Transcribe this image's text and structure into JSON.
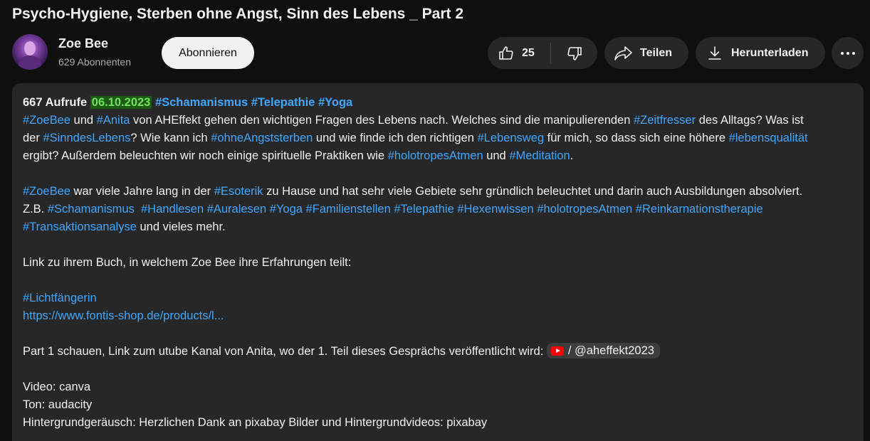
{
  "video": {
    "title": "Psycho-Hygiene, Sterben ohne Angst, Sinn des Lebens _ Part 2"
  },
  "channel": {
    "name": "Zoe Bee",
    "subscribers": "629 Abonnenten",
    "subscribe_label": "Abonnieren"
  },
  "actions": {
    "like_count": "25",
    "share_label": "Teilen",
    "download_label": "Herunterladen"
  },
  "description": {
    "views": "667 Aufrufe",
    "date": "06.10.2023",
    "header_tags": [
      "#Schamanismus",
      "#Telepathie",
      "#Yoga"
    ],
    "p1": {
      "t1": "#ZoeBee",
      "s1": " und ",
      "t2": "#Anita",
      "s2": " von AHEffekt gehen den wichtigen Fragen des Lebens nach. Welches sind die manipulierenden ",
      "t3": "#Zeitfresser",
      "s3": " des Alltags? Was ist",
      "s4": "der ",
      "t4": "#SinndesLebens",
      "s5": "? Wie kann ich ",
      "t5": "#ohneAngststerben",
      "s6": " und wie finde ich den richtigen ",
      "t6": "#Lebensweg",
      "s7": " für mich, so dass sich eine höhere ",
      "t7": "#lebensqualität",
      "s8": "ergibt? Außerdem beleuchten wir noch einige spirituelle Praktiken wie ",
      "t8": "#holotropesAtmen",
      "s9": " und ",
      "t9": "#Meditation",
      "s10": "."
    },
    "p2": {
      "t1": "#ZoeBee",
      "s1": " war viele Jahre lang in der ",
      "t2": "#Esoterik",
      "s2": " zu Hause und hat sehr viele Gebiete sehr gründlich beleuchtet und darin auch Ausbildungen absolviert.",
      "s3": "Z.B. ",
      "tags": [
        "#Schamanismus",
        "#Handlesen",
        "#Auralesen",
        "#Yoga",
        "#Familienstellen",
        "#Telepathie",
        "#Hexenwissen",
        "#holotropesAtmen",
        "#Reinkarnationstherapie"
      ],
      "t3": "#Transaktionsanalyse",
      "s4": " und vieles mehr."
    },
    "book_intro": "Link zu ihrem Buch, in welchem Zoe Bee ihre Erfahrungen teilt:",
    "book_tag": "#Lichtfängerin",
    "book_link": "https://www.fontis-shop.de/products/l...",
    "part1_text": "Part 1 schauen, Link zum utube Kanal von Anita, wo der 1. Teil dieses Gesprächs veröffentlicht wird: ",
    "part1_chip": "/ @aheffekt2023",
    "credits": [
      "Video: canva",
      "Ton: audacity",
      "Hintergrundgeräusch: Herzlichen Dank an pixabay Bilder und Hintergrundvideos: pixabay"
    ]
  },
  "colors": {
    "background": "#0f0f0f",
    "panel": "#272727",
    "link": "#3ea6ff",
    "date_highlight": "#1f5a14"
  },
  "icons": [
    "thumb-up-icon",
    "thumb-down-icon",
    "share-arrow-icon",
    "download-icon",
    "more-icon",
    "youtube-icon"
  ]
}
